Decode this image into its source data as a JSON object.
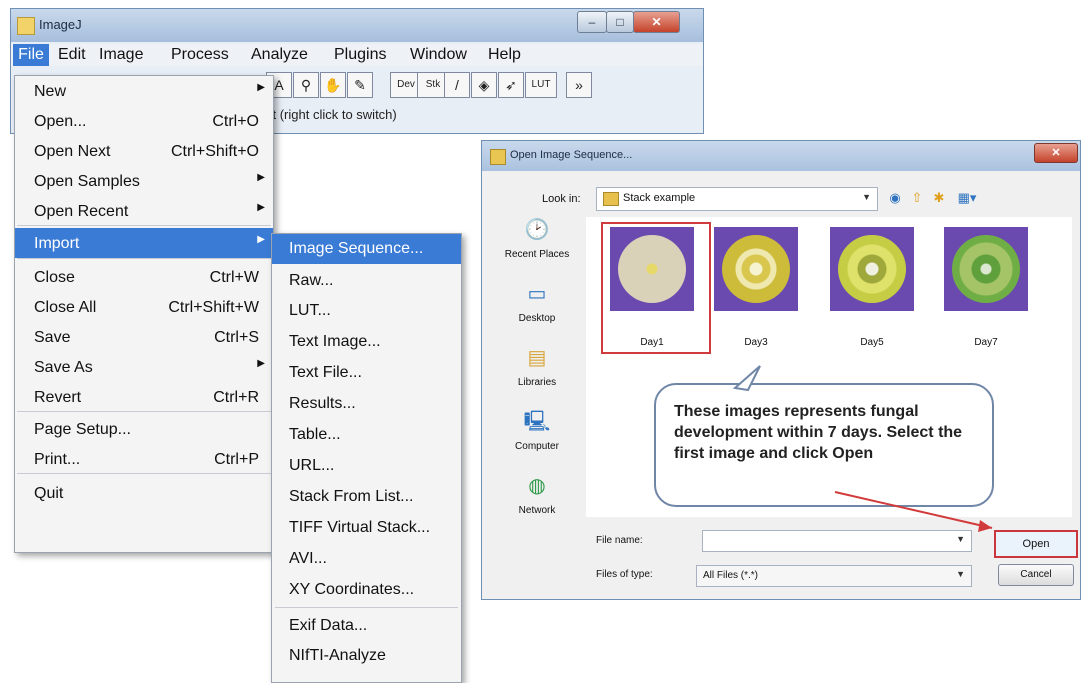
{
  "imagej": {
    "title": "ImageJ",
    "menubar": [
      "File",
      "Edit",
      "Image",
      "Process",
      "Analyze",
      "Plugins",
      "Window",
      "Help"
    ],
    "toolbar": [
      {
        "icon": "text-tool-icon",
        "label": "A"
      },
      {
        "icon": "magnifier-icon",
        "label": "⚲"
      },
      {
        "icon": "hand-icon",
        "label": "✋"
      },
      {
        "icon": "color-picker-icon",
        "label": "✎"
      },
      {
        "icon": "dev-icon",
        "label": "Dev"
      },
      {
        "icon": "stk-icon",
        "label": "Stk"
      },
      {
        "icon": "brush-icon",
        "label": "/"
      },
      {
        "icon": "flood-fill-icon",
        "label": "◈"
      },
      {
        "icon": "arrow-tool-icon",
        "label": "➶"
      },
      {
        "icon": "lut-icon",
        "label": "LUT"
      },
      {
        "icon": "more-tools-icon",
        "label": "»"
      }
    ],
    "status_text": "ct (right click to switch)"
  },
  "file_menu": {
    "items": [
      {
        "label": "New",
        "shortcut": "",
        "submenu": true
      },
      {
        "label": "Open...",
        "shortcut": "Ctrl+O",
        "submenu": false
      },
      {
        "label": "Open Next",
        "shortcut": "Ctrl+Shift+O",
        "submenu": false
      },
      {
        "label": "Open Samples",
        "shortcut": "",
        "submenu": true
      },
      {
        "label": "Open Recent",
        "shortcut": "",
        "submenu": true
      },
      {
        "label": "Import",
        "shortcut": "",
        "submenu": true
      },
      {
        "label": "Close",
        "shortcut": "Ctrl+W",
        "submenu": false
      },
      {
        "label": "Close All",
        "shortcut": "Ctrl+Shift+W",
        "submenu": false
      },
      {
        "label": "Save",
        "shortcut": "Ctrl+S",
        "submenu": false
      },
      {
        "label": "Save As",
        "shortcut": "",
        "submenu": true
      },
      {
        "label": "Revert",
        "shortcut": "Ctrl+R",
        "submenu": false
      },
      {
        "label": "Page Setup...",
        "shortcut": "",
        "submenu": false
      },
      {
        "label": "Print...",
        "shortcut": "Ctrl+P",
        "submenu": false
      },
      {
        "label": "Quit",
        "shortcut": "",
        "submenu": false
      }
    ],
    "highlighted": "Import"
  },
  "import_menu": {
    "items": [
      "Image Sequence...",
      "Raw...",
      "LUT...",
      "Text Image...",
      "Text File...",
      "Results...",
      "Table...",
      "URL...",
      "Stack From List...",
      "TIFF Virtual Stack...",
      "AVI...",
      "XY Coordinates...",
      "Exif Data...",
      "NIfTI-Analyze"
    ],
    "highlighted": "Image Sequence..."
  },
  "dialog": {
    "title": "Open Image Sequence...",
    "look_in_label": "Look in:",
    "look_in_value": "Stack example",
    "places": [
      {
        "label": "Recent Places",
        "icon": "recent-places-icon"
      },
      {
        "label": "Desktop",
        "icon": "desktop-icon"
      },
      {
        "label": "Libraries",
        "icon": "libraries-icon"
      },
      {
        "label": "Computer",
        "icon": "computer-icon"
      },
      {
        "label": "Network",
        "icon": "network-icon"
      }
    ],
    "files": [
      {
        "name": "Day1",
        "selected": true
      },
      {
        "name": "Day3",
        "selected": false
      },
      {
        "name": "Day5",
        "selected": false
      },
      {
        "name": "Day7",
        "selected": false
      }
    ],
    "file_name_label": "File name:",
    "file_name_value": "",
    "files_of_type_label": "Files of type:",
    "files_of_type_value": "All Files (*.*)",
    "open_label": "Open",
    "cancel_label": "Cancel"
  },
  "callout": {
    "text": "These images represents fungal development within 7 days. Select the first image and click Open"
  },
  "colors": {
    "menu_highlight": "#3a7bd5",
    "annotation_red": "#d23b3b",
    "dish_purple": "#6b4ab0"
  }
}
